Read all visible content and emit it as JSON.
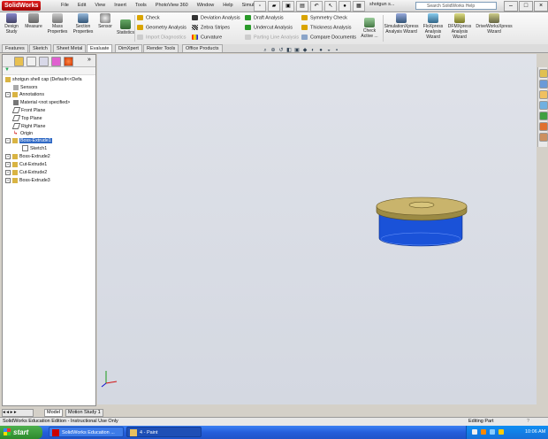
{
  "app": {
    "logo": "SolidWorks",
    "doc_title": "shotgun s..."
  },
  "menu": [
    "File",
    "Edit",
    "View",
    "Insert",
    "Tools",
    "PhotoView 360",
    "Window",
    "Help",
    "SimulCAM"
  ],
  "help_search": {
    "placeholder": "Search SolidWorks Help"
  },
  "ribbon": {
    "big_buttons": [
      "Design Study",
      "Measure",
      "Mass Properties",
      "Section Properties",
      "Sensor",
      "Statistics"
    ],
    "col1": [
      {
        "label": "Check",
        "enabled": true
      },
      {
        "label": "Geometry Analysis",
        "enabled": true
      },
      {
        "label": "Import Diagnostics",
        "enabled": false
      }
    ],
    "col2": [
      {
        "label": "Deviation Analysis",
        "enabled": true
      },
      {
        "label": "Zebra Stripes",
        "enabled": true
      },
      {
        "label": "Curvature",
        "enabled": true
      }
    ],
    "col3": [
      {
        "label": "Draft Analysis",
        "enabled": true
      },
      {
        "label": "Undercut Analysis",
        "enabled": true
      },
      {
        "label": "Parting Line Analysis",
        "enabled": false
      }
    ],
    "col4": [
      {
        "label": "Symmetry Check",
        "enabled": true
      },
      {
        "label": "Thickness Analysis",
        "enabled": true
      },
      {
        "label": "Compare Documents",
        "enabled": true
      }
    ],
    "check_active": "Check Active ...",
    "wizards": [
      "SimulationXpress Analysis Wizard",
      "FloXpress Analysis Wizard",
      "DFMXpress Analysis Wizard",
      "DriveWorksXpress Wizard"
    ]
  },
  "tabs": [
    "Features",
    "Sketch",
    "Sheet Metal",
    "Evaluate",
    "DimXpert",
    "Render Tools",
    "Office Products"
  ],
  "active_tab": "Evaluate",
  "tree": {
    "root": "shotgun shell cap  (Default<<Defa",
    "items": [
      {
        "label": "Sensors"
      },
      {
        "label": "Annotations"
      },
      {
        "label": "Material <not specified>"
      },
      {
        "label": "Front Plane"
      },
      {
        "label": "Top Plane"
      },
      {
        "label": "Right Plane"
      },
      {
        "label": "Origin"
      },
      {
        "label": "Boss-Extrude1"
      },
      {
        "label": "Sketch1"
      },
      {
        "label": "Boss-Extrude2"
      },
      {
        "label": "Cut-Extrude1"
      },
      {
        "label": "Cut-Extrude2"
      },
      {
        "label": "Boss-Extrude3"
      }
    ]
  },
  "model_tabs": [
    "Model",
    "Motion Study 1"
  ],
  "status": {
    "left": "SolidWorks Education Edition - Instructional Use Only",
    "right": "Editing Part"
  },
  "taskbar": {
    "start": "start",
    "tasks": [
      "SolidWorks Education ...",
      "4 - Paint"
    ],
    "clock": "10:06 AM"
  },
  "colors": {
    "cap_top": "#c9b46c",
    "cap_body": "#1a52d8"
  }
}
